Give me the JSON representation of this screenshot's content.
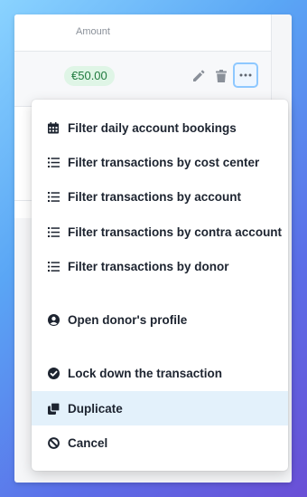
{
  "table": {
    "header_amount": "Amount",
    "row_amount": "€50.00"
  },
  "row_actions": {
    "edit_icon": "pencil-icon",
    "delete_icon": "trash-icon",
    "more_icon": "ellipsis-icon"
  },
  "menu": {
    "items": [
      {
        "label": "Filter daily account bookings",
        "icon": "calendar-icon"
      },
      {
        "label": "Filter transactions by cost center",
        "icon": "list-icon"
      },
      {
        "label": "Filter transactions by account",
        "icon": "list-icon"
      },
      {
        "label": "Filter transactions by contra account",
        "icon": "list-icon"
      },
      {
        "label": "Filter transactions by donor",
        "icon": "list-icon"
      },
      {
        "label": "Open donor's profile",
        "icon": "user-circle-icon"
      },
      {
        "label": "Lock down the transaction",
        "icon": "check-circle-icon"
      },
      {
        "label": "Duplicate",
        "icon": "copy-icon"
      },
      {
        "label": "Cancel",
        "icon": "ban-icon"
      }
    ],
    "highlighted": "Duplicate"
  },
  "colors": {
    "badge_bg": "#dff5e6",
    "badge_text": "#1f7a3e",
    "highlight": "#e3f1fb",
    "focus_ring": "#8ec8ff"
  }
}
